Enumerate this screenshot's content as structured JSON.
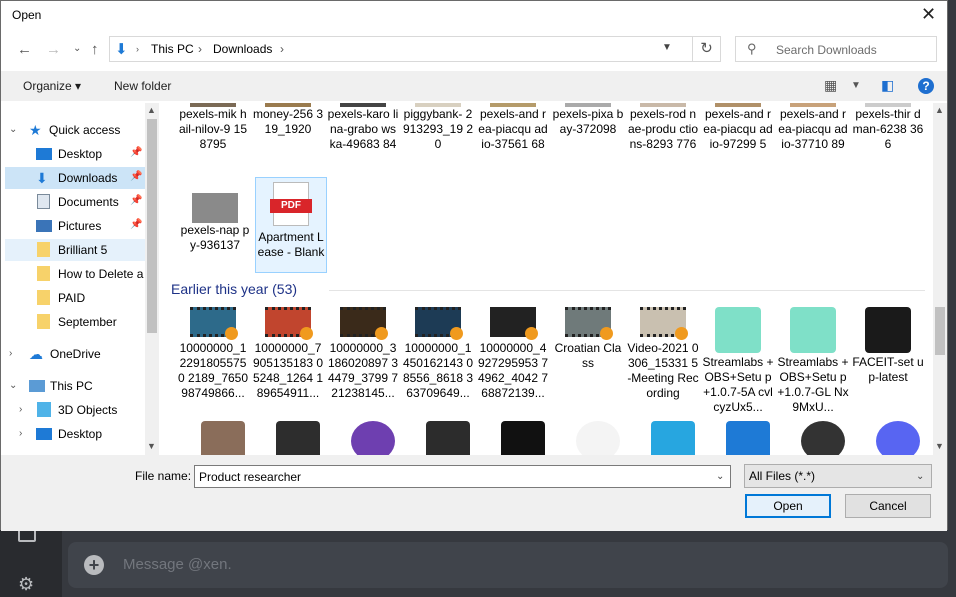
{
  "background": {
    "message_placeholder": "Message @xen."
  },
  "dialog": {
    "title": "Open",
    "breadcrumb": [
      "This PC",
      "Downloads"
    ],
    "search_placeholder": "Search Downloads",
    "toolbar": {
      "organize": "Organize",
      "new_folder": "New folder"
    },
    "nav": [
      {
        "label": "Quick access"
      },
      {
        "label": "Desktop"
      },
      {
        "label": "Downloads"
      },
      {
        "label": "Documents"
      },
      {
        "label": "Pictures"
      },
      {
        "label": "Brilliant 5"
      },
      {
        "label": "How to Delete a"
      },
      {
        "label": "PAID"
      },
      {
        "label": "September"
      },
      {
        "label": "OneDrive"
      },
      {
        "label": "This PC"
      },
      {
        "label": "3D Objects"
      },
      {
        "label": "Desktop"
      }
    ],
    "files_top": [
      "pexels-mik hail-nilov-9 158795",
      "money-256 319_1920",
      "pexels-karo lina-grabo wska-49683 84",
      "piggybank- 2913293_19 20",
      "pexels-and rea-piacqu adio-37561 68",
      "pexels-pixa bay-372098",
      "pexels-rod nae-produ ctions-8293 776",
      "pexels-and rea-piacqu adio-97299 5",
      "pexels-and rea-piacqu adio-37710 89",
      "pexels-thir dman-6238 366"
    ],
    "files_second": [
      "pexels-nap py-936137",
      "Apartment Lease - Blank"
    ],
    "pdf_tag": "PDF",
    "group_header": "Earlier this year (53)",
    "files_earlier": [
      "10000000_1 22918055750 2189_7650 98749866...",
      "10000000_7 905135183 05248_1264 189654911...",
      "10000000_3 186020897 34479_3799 721238145...",
      "10000000_1 450162143 08556_8618 363709649...",
      "10000000_4 927295953 74962_4042 768872139...",
      "Croatian Class",
      "Video-2021 0306_15331 5-Meeting Recording",
      "Streamlabs +OBS+Setu p+1.0.7-5A cvlcyzUx5...",
      "Streamlabs +OBS+Setu p+1.0.7-GL Nx9MxU...",
      "FACEIT-set up-latest"
    ],
    "file_name_label": "File name:",
    "file_name_value": "Product researcher",
    "file_type": "All Files (*.*)",
    "open_button": "Open",
    "cancel_button": "Cancel",
    "colors": {
      "accent": "#0078d7",
      "selected": "#cce4f7",
      "group_header": "#1e3287"
    }
  }
}
